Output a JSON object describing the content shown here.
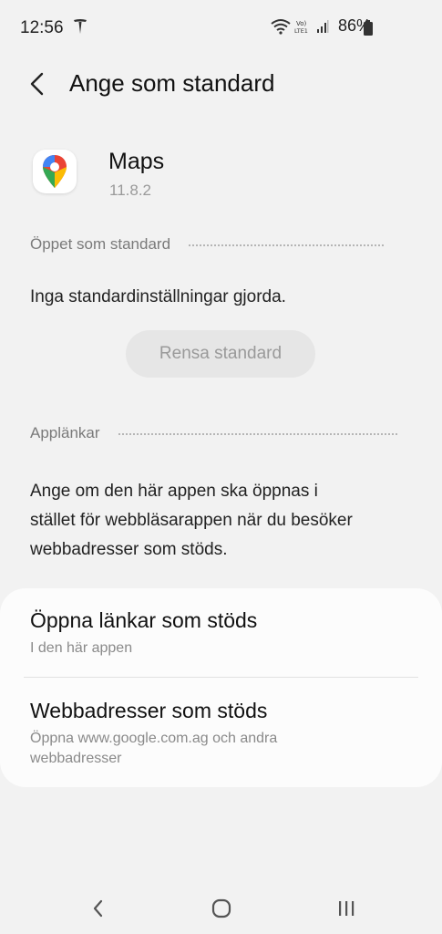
{
  "status_bar": {
    "time": "12:56",
    "battery": "86%",
    "icons": [
      "tesla-icon",
      "wifi-icon",
      "volte-icon",
      "signal-icon",
      "battery-icon"
    ]
  },
  "header": {
    "title": "Ange som standard",
    "back_icon": "back-arrow-icon"
  },
  "app": {
    "name": "Maps",
    "version": "11.8.2",
    "icon": "google-maps-icon"
  },
  "opened_by_default": {
    "heading": "Öppet som standard",
    "description": "Inga standardinställningar gjorda.",
    "clear_button": "Rensa standard"
  },
  "app_links": {
    "heading": "Applänkar",
    "description_lines": [
      "Ange om den här appen ska öppnas i",
      "stället för webbläsarappen när du besöker",
      "webbadresser som stöds."
    ],
    "items": [
      {
        "title": "Öppna länkar som stöds",
        "subtitle_lines": [
          "I den här appen"
        ]
      },
      {
        "title": "Webbadresser som stöds",
        "subtitle_lines": [
          "Öppna www.google.com.ag och andra",
          "webbadresser"
        ]
      }
    ]
  },
  "nav_bar": {
    "buttons": [
      "back-nav-icon",
      "home-nav-icon",
      "recents-nav-icon"
    ]
  },
  "colors": {
    "background": "#f2f2f2",
    "card": "#fcfcfc",
    "disabled_button": "#e6e6e6",
    "secondary_text": "#8a8a8a"
  }
}
